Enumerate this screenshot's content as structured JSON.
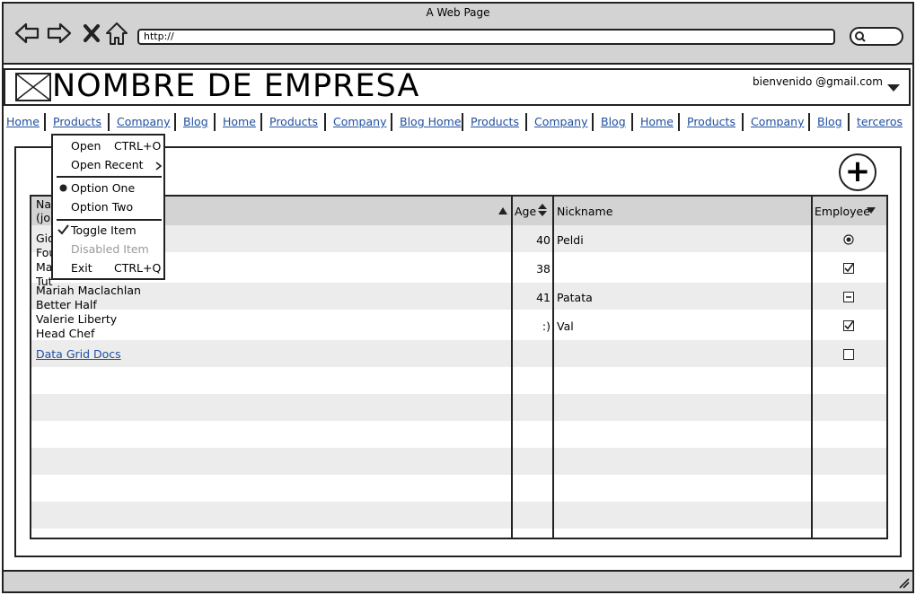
{
  "browser": {
    "title": "A Web Page",
    "url": "http://",
    "icons": [
      "back-icon",
      "forward-icon",
      "close-icon",
      "home-icon",
      "search-icon",
      "resize-grip-icon"
    ]
  },
  "header": {
    "company": "NOMBRE DE EMPRESA",
    "user_email": "bienvenido @gmail.com"
  },
  "nav": [
    "Home",
    "Products",
    "Company",
    "Blog",
    "Home",
    "Products",
    "Company",
    "Blog Home",
    "Products",
    "Company",
    "Blog",
    "Home",
    "Products",
    "Company",
    "Blog",
    "terceros"
  ],
  "grid": {
    "columns": {
      "name": "Na",
      "age": "Age",
      "nickname": "Nickname",
      "employee": "Employee"
    },
    "name_header_second_line": "(jol",
    "rows": [
      {
        "name_line1": "Gio",
        "name_line2": "Fou",
        "age": "40",
        "nickname": "Peldi",
        "employee": "radio-selected"
      },
      {
        "name_line1": "Ma",
        "name_line2": "Tut",
        "age": "38",
        "nickname": "",
        "employee": "checkbox-checked"
      },
      {
        "name_line1": "Mariah Maclachlan",
        "name_line2": "Better Half",
        "age": "41",
        "nickname": "Patata",
        "employee": "checkbox-indeterminate"
      },
      {
        "name_line1": "Valerie Liberty",
        "name_line2": "Head Chef",
        "age": ":)",
        "nickname": "Val",
        "employee": "checkbox-checked"
      }
    ],
    "docs_link": "Data Grid Docs"
  },
  "menu": {
    "items": [
      {
        "label": "Open",
        "shortcut": "CTRL+O"
      },
      {
        "label": "Open Recent",
        "submenu": true
      },
      {
        "label": "Option One",
        "selected": true
      },
      {
        "label": "Option Two"
      },
      {
        "label": "Toggle Item",
        "checked": true
      },
      {
        "label": "Disabled Item",
        "disabled": true
      },
      {
        "label": "Exit",
        "shortcut": "CTRL+Q"
      }
    ]
  },
  "add_button": "+"
}
